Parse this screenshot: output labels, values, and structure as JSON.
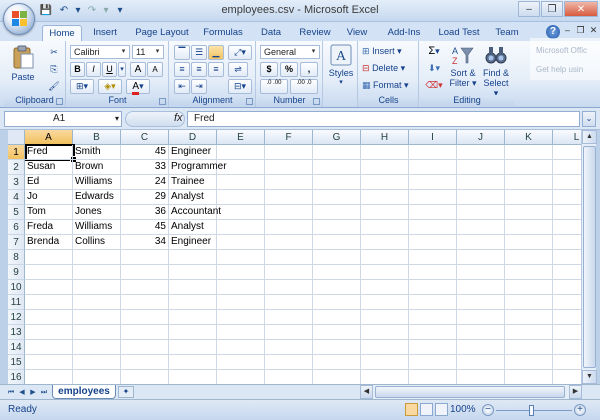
{
  "window": {
    "title": "employees.csv - Microsoft Excel"
  },
  "qat": {
    "save_icon": "💾",
    "undo_icon": "↶",
    "redo_icon": "↷",
    "customize_icon": "▾"
  },
  "tabs": [
    {
      "label": "Home",
      "active": true
    },
    {
      "label": "Insert"
    },
    {
      "label": "Page Layout"
    },
    {
      "label": "Formulas"
    },
    {
      "label": "Data"
    },
    {
      "label": "Review"
    },
    {
      "label": "View"
    },
    {
      "label": "Add-Ins"
    },
    {
      "label": "Load Test"
    },
    {
      "label": "Team"
    }
  ],
  "help": {
    "label": "?"
  },
  "tooltip": {
    "line1": "Microsoft Offic",
    "line2": "Get help usin"
  },
  "ribbon": {
    "clipboard": {
      "label": "Clipboard",
      "paste": "Paste"
    },
    "font": {
      "label": "Font",
      "name": "Calibri",
      "size": "11",
      "bold": "B",
      "italic": "I",
      "underline": "U",
      "grow": "A",
      "shrink": "A",
      "fontcolor": "A"
    },
    "alignment": {
      "label": "Alignment"
    },
    "number": {
      "label": "Number",
      "format": "General",
      "currency": "$",
      "percent": "%",
      "comma": ",",
      "inc_decimal": ".0 .00",
      "dec_decimal": ".00 .0"
    },
    "styles": {
      "label": "Styles"
    },
    "cells": {
      "label": "Cells",
      "insert": "Insert",
      "delete": "Delete",
      "format": "Format"
    },
    "editing": {
      "label": "Editing",
      "sum": "Σ",
      "sort": "Sort &",
      "filter": "Filter",
      "find": "Find &",
      "select": "Select"
    }
  },
  "formula_bar": {
    "name_box": "A1",
    "fx": "fx",
    "value": "Fred"
  },
  "columns": [
    "A",
    "B",
    "C",
    "D",
    "E",
    "F",
    "G",
    "H",
    "I",
    "J",
    "K",
    "L"
  ],
  "rows": [
    "1",
    "2",
    "3",
    "4",
    "5",
    "6",
    "7",
    "8",
    "9",
    "10",
    "11",
    "12",
    "13",
    "14",
    "15",
    "16"
  ],
  "cells": [
    [
      "Fred",
      "Smith",
      "45",
      "Engineer"
    ],
    [
      "Susan",
      "Brown",
      "33",
      "Programmer"
    ],
    [
      "Ed",
      "Williams",
      "24",
      "Trainee"
    ],
    [
      "Jo",
      "Edwards",
      "29",
      "Analyst"
    ],
    [
      "Tom",
      "Jones",
      "36",
      "Accountant"
    ],
    [
      "Freda",
      "Williams",
      "45",
      "Analyst"
    ],
    [
      "Brenda",
      "Collins",
      "34",
      "Engineer"
    ]
  ],
  "sheet": {
    "name": "employees"
  },
  "status": {
    "ready": "Ready",
    "zoom": "100%"
  }
}
